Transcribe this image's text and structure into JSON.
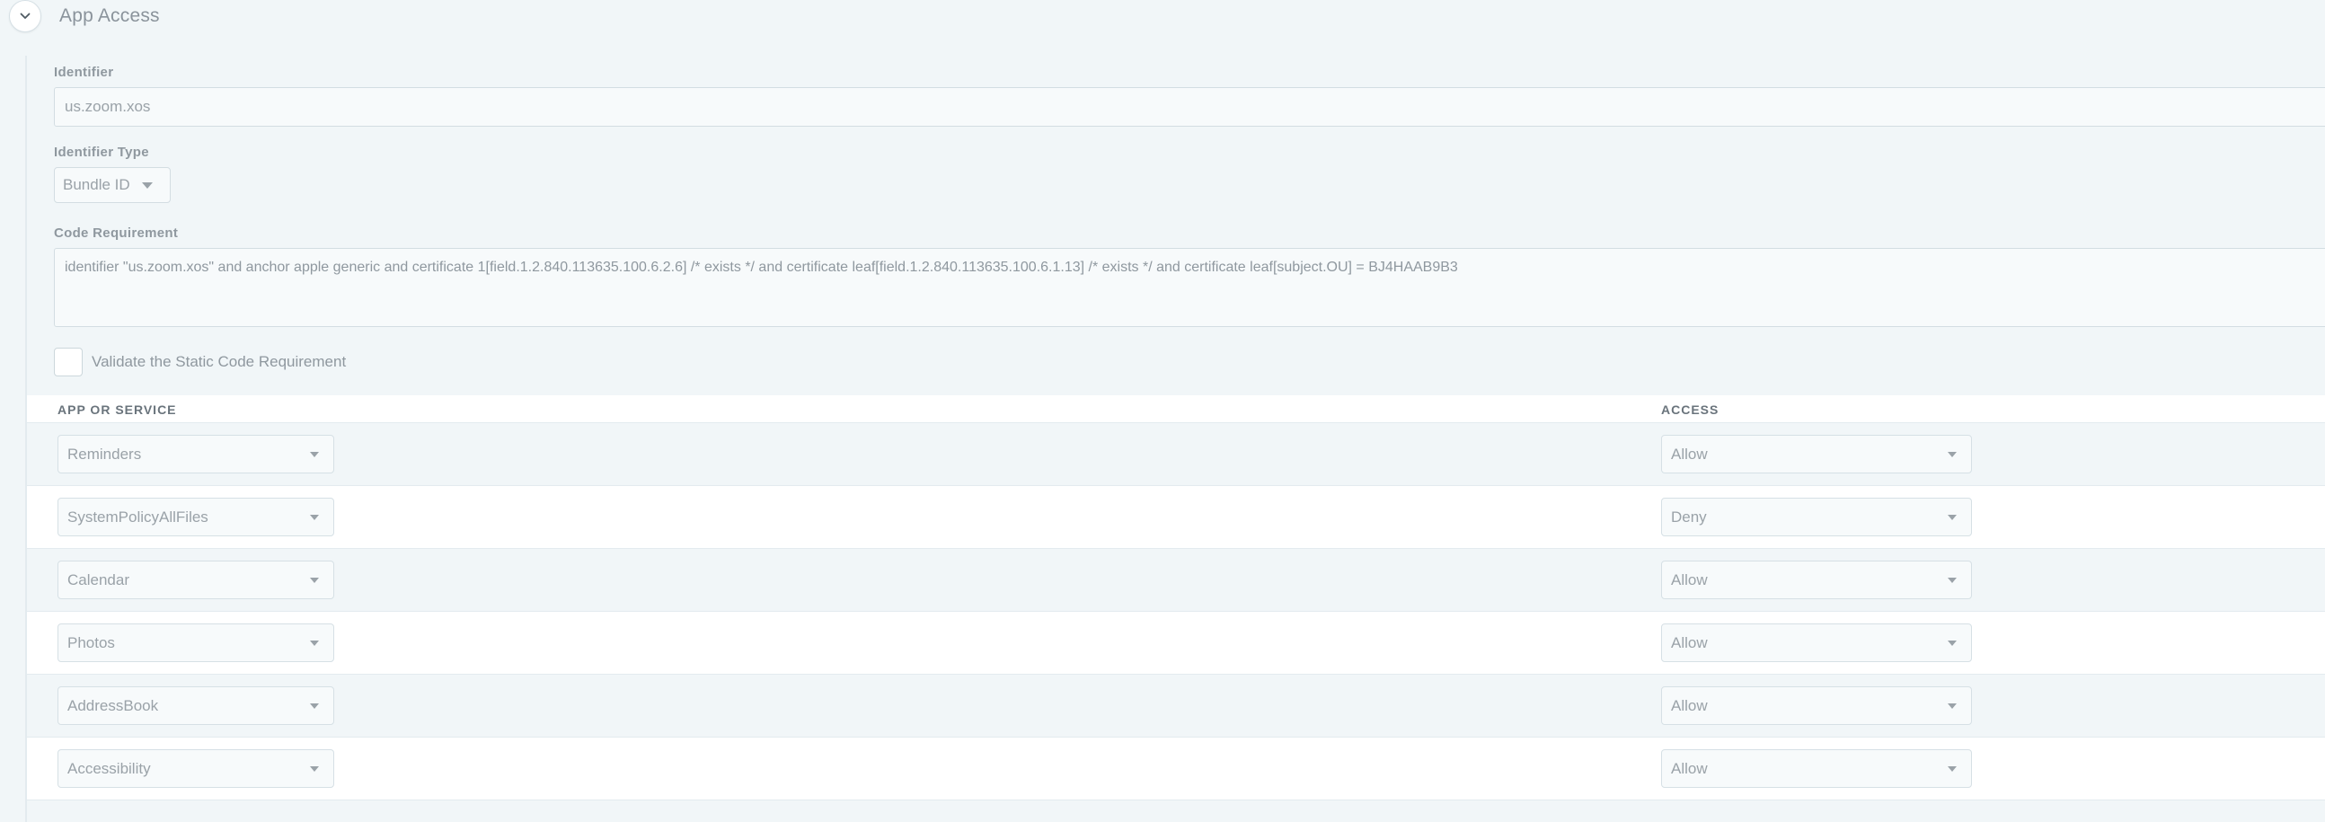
{
  "section": {
    "title": "App Access",
    "collapse_icon": "chevron-down-icon"
  },
  "identifier": {
    "label": "Identifier",
    "value": "us.zoom.xos"
  },
  "identifier_type": {
    "label": "Identifier Type",
    "value": "Bundle ID"
  },
  "code_requirement": {
    "label": "Code Requirement",
    "value": "identifier \"us.zoom.xos\" and anchor apple generic and certificate 1[field.1.2.840.113635.100.6.2.6] /* exists */ and certificate leaf[field.1.2.840.113635.100.6.1.13] /* exists */ and certificate leaf[subject.OU] = BJ4HAAB9B3"
  },
  "validate_checkbox": {
    "label": "Validate the Static Code Requirement",
    "checked": false
  },
  "table": {
    "headers": {
      "app": "APP OR SERVICE",
      "access": "ACCESS"
    },
    "rows": [
      {
        "app": "Reminders",
        "access": "Allow"
      },
      {
        "app": "SystemPolicyAllFiles",
        "access": "Deny"
      },
      {
        "app": "Calendar",
        "access": "Allow"
      },
      {
        "app": "Photos",
        "access": "Allow"
      },
      {
        "app": "AddressBook",
        "access": "Allow"
      },
      {
        "app": "Accessibility",
        "access": "Allow"
      }
    ]
  },
  "colors": {
    "page_bg": "#f1f6f8",
    "row_alt_bg": "#ffffff",
    "border": "#d3dde2",
    "text_muted": "#9aa2a8",
    "header_text": "#6a747c"
  }
}
